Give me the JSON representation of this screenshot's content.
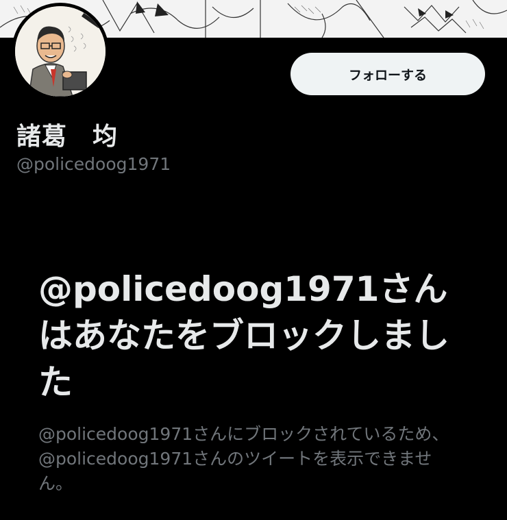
{
  "profile": {
    "display_name": "諸葛　均",
    "handle": "@policedoog1971",
    "banner_icon": "manga-banner-image",
    "avatar_icon": "cartoon-avatar-image"
  },
  "actions": {
    "follow_label": "フォローする"
  },
  "blocked": {
    "title": "@policedoog1971さんはあなたをブロックしました",
    "description": "@policedoog1971さんにブロックされているため、@policedoog1971さんのツイートを表示できません。"
  },
  "colors": {
    "background": "#000000",
    "primary_text": "#e7e9ea",
    "secondary_text": "#71767b",
    "button_bg": "#eff3f4",
    "button_text": "#0f1419"
  }
}
